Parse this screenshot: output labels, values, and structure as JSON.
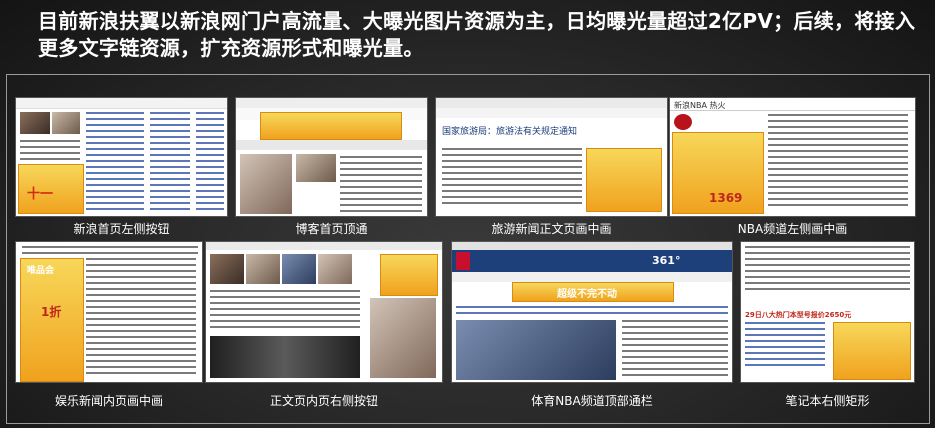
{
  "title": "目前新浪扶翼以新浪网门户高流量、大曝光图片资源为主，日均曝光量超过2亿PV；后续，将接入更多文字链资源，扩充资源形式和曝光量。",
  "thumbnails": [
    {
      "caption": "新浪首页左侧按钮"
    },
    {
      "caption": "博客首页顶通"
    },
    {
      "caption": "旅游新闻正文页画中画"
    },
    {
      "caption": "NBA频道左侧画中画"
    },
    {
      "caption": "娱乐新闻内页画中画"
    },
    {
      "caption": "正文页内页右侧按钮"
    },
    {
      "caption": "体育NBA频道顶部通栏"
    },
    {
      "caption": "笔记本右侧矩形"
    }
  ],
  "thumb_text": {
    "travel_headline": "国家旅游局：旅游法有关规定通知",
    "nba_header": "新浪NBA 热火",
    "nba_ad_number": "1369",
    "ent_ad_label": "唯品会",
    "ent_ad_price": "1折",
    "sports_ad_brand": "361°",
    "sports_ad_text": "超级不完不动",
    "notebook_promo": "29日八大热门本型号报价2650元"
  },
  "colors": {
    "accent_ad": "#f0a21e",
    "ad_text": "#c0261a",
    "sina_blue": "#1b5fb0"
  }
}
